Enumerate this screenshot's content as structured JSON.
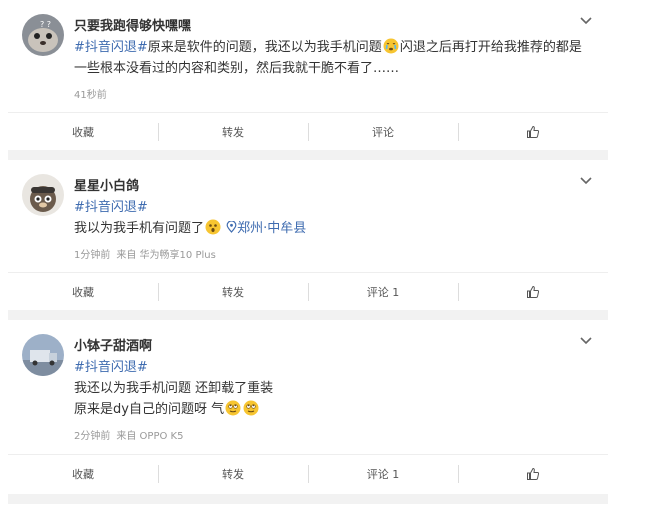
{
  "posts": [
    {
      "username": "只要我跑得够快嘿嘿",
      "hashtag": "#抖音闪退#",
      "text_a": "原来是软件的问题，我还以为我手机问题",
      "text_b": "闪退之后再打开给我推荐的都是一些根本没看过的内容和类别，然后我就干脆不看了……",
      "time": "41秒前",
      "actions": {
        "favorite": "收藏",
        "repost": "转发",
        "comment": "评论"
      }
    },
    {
      "username": "星星小白鸽",
      "hashtag": "#抖音闪退#",
      "line1": "我以为我手机有问题了",
      "location": "郑州·中牟县",
      "time": "1分钟前",
      "source": "来自 华为畅享10 Plus",
      "actions": {
        "favorite": "收藏",
        "repost": "转发",
        "comment": "评论 1"
      }
    },
    {
      "username": "小钵子甜酒啊",
      "hashtag": "#抖音闪退#",
      "line1": "我还以为我手机问题 还卸载了重装",
      "line2": "原来是dy自己的问题呀 气",
      "time": "2分钟前",
      "source": "来自 OPPO K5",
      "actions": {
        "favorite": "收藏",
        "repost": "转发",
        "comment": "评论 1"
      }
    }
  ],
  "icons": {
    "more": "chevron-down-icon",
    "like": "thumbs-up-icon",
    "location": "location-pin-icon"
  },
  "colors": {
    "link": "#3f6cb0",
    "meta": "#999999",
    "divider": "#f2f2f2"
  }
}
